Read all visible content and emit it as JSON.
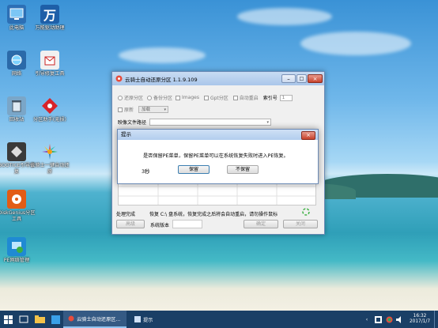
{
  "desktop": {
    "icons": [
      {
        "label": "此电脑",
        "icon": "computer-icon"
      },
      {
        "label": "网络",
        "icon": "network-icon"
      },
      {
        "label": "回收站",
        "icon": "recycle-bin-icon"
      },
      {
        "label": "BOOTICE引导修复",
        "icon": "bootice-icon"
      },
      {
        "label": "DiskGenius分区工具",
        "icon": "diskgenius-icon"
      },
      {
        "label": "PE网络管理",
        "icon": "pe-network-icon"
      },
      {
        "label": "万能驱动助理",
        "icon": "wan-driver-icon"
      },
      {
        "label": "引导修复工具",
        "icon": "boot-repair-icon"
      },
      {
        "label": "分区助手(无损)",
        "icon": "partition-assistant-icon"
      },
      {
        "label": "云骑士一键自动还原",
        "icon": "yunqishi-icon"
      }
    ]
  },
  "window": {
    "title": "云骑士自动还原分区 1.1.9.109",
    "min": "–",
    "max": "□",
    "close": "×",
    "opt_restore": "还原分区",
    "opt_backup": "备份分区",
    "opt_images": "Images",
    "opt_ghost": "Gpt分区",
    "opt_autoreboot": "自动重启",
    "index_label": "索引号",
    "index_value": "1",
    "source_label": "原新",
    "source_value": "加载",
    "image_path_label": "映像文件路径",
    "status_label": "处理完成",
    "status_text": "恢复 C:\\ 盘系统，恢复完成之后将会自动重启，请勿操作鼠标",
    "btn_advanced": "高级",
    "system_version_label": "系统版本",
    "btn_confirm": "确定",
    "btn_cancel": "关闭"
  },
  "dialog": {
    "title": "提示",
    "close": "×",
    "message": "是否保留PE菜单，保留PE菜单可以在系统恢复失败时进入PE恢复。",
    "countdown": "3秒",
    "btn_keep": "保留",
    "btn_discard": "不保留"
  },
  "taskbar": {
    "item1": "云骑士自动还原区...",
    "item2": "提示",
    "time": "16:32",
    "date": "2017/1/7"
  }
}
